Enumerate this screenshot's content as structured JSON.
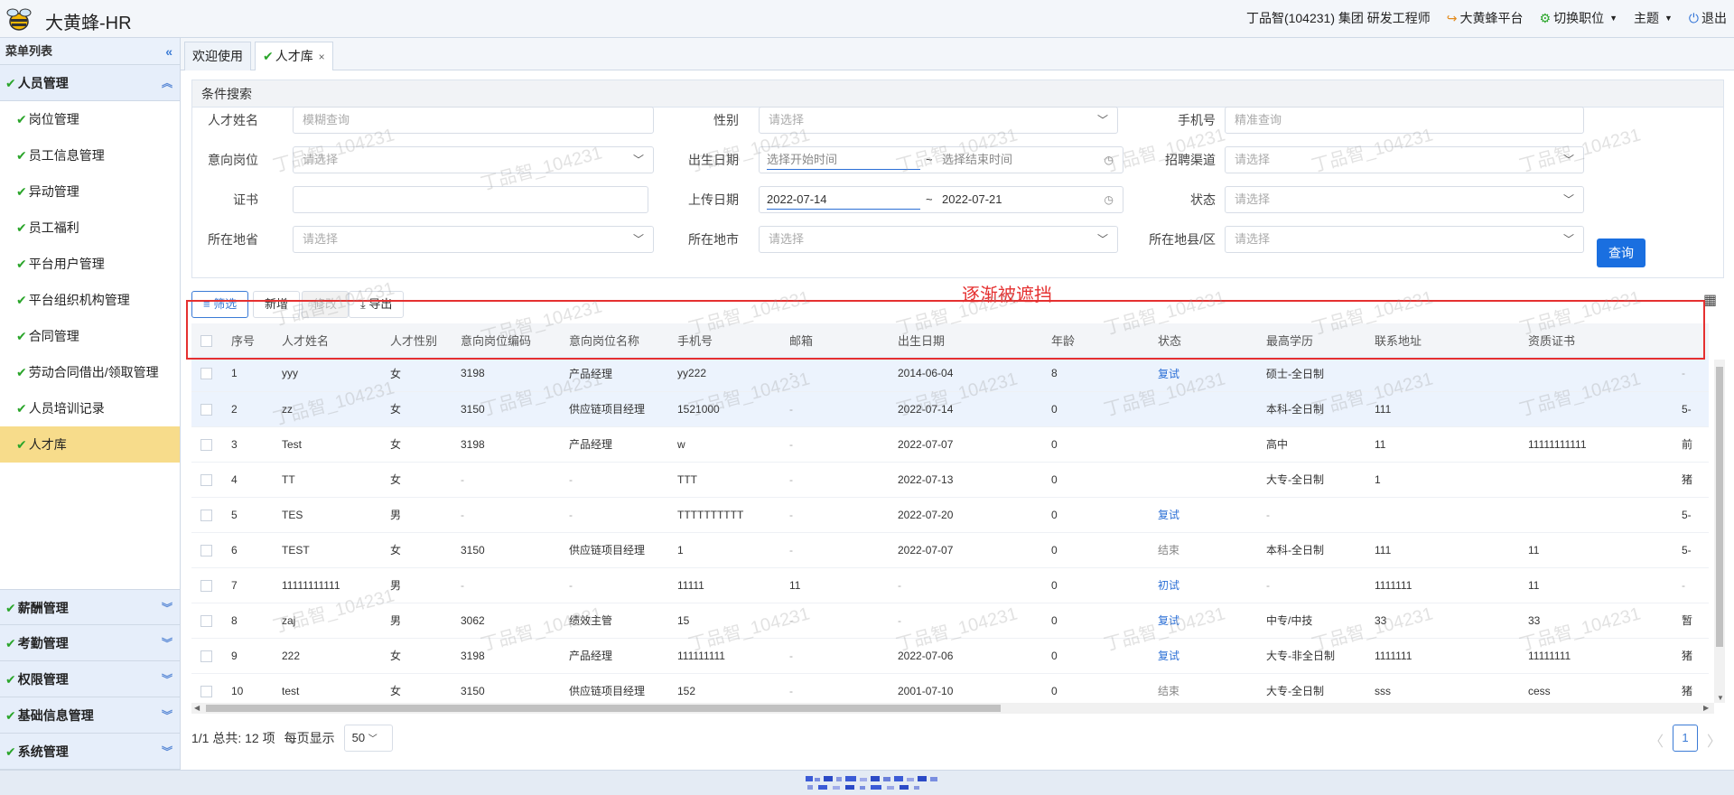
{
  "app": {
    "title": "大黄蜂-HR"
  },
  "topbar": {
    "user": "丁品智(104231) 集团 研发工程师",
    "platform": "大黄蜂平台",
    "switch_role": "切换职位",
    "theme": "主题",
    "logout": "退出"
  },
  "sidebar": {
    "header": "菜单列表",
    "active_group": "人员管理",
    "items": [
      {
        "label": "岗位管理"
      },
      {
        "label": "员工信息管理"
      },
      {
        "label": "异动管理"
      },
      {
        "label": "员工福利"
      },
      {
        "label": "平台用户管理"
      },
      {
        "label": "平台组织机构管理"
      },
      {
        "label": "合同管理"
      },
      {
        "label": "劳动合同借出/领取管理"
      },
      {
        "label": "人员培训记录"
      },
      {
        "label": "人才库"
      }
    ],
    "groups": [
      {
        "label": "薪酬管理"
      },
      {
        "label": "考勤管理"
      },
      {
        "label": "权限管理"
      },
      {
        "label": "基础信息管理"
      },
      {
        "label": "系统管理"
      }
    ]
  },
  "tabs": [
    {
      "label": "欢迎使用"
    },
    {
      "label": "人才库"
    }
  ],
  "search": {
    "title": "条件搜索",
    "name_label": "人才姓名",
    "name_placeholder": "模糊查询",
    "gender_label": "性别",
    "gender_placeholder": "请选择",
    "phone_label": "手机号",
    "phone_placeholder": "精准查询",
    "position_label": "意向岗位",
    "position_placeholder": "请选择",
    "birth_label": "出生日期",
    "birth_start": "选择开始时间",
    "birth_end": "选择结束时间",
    "channel_label": "招聘渠道",
    "channel_placeholder": "请选择",
    "cert_label": "证书",
    "upload_label": "上传日期",
    "upload_start": "2022-07-14",
    "upload_end": "2022-07-21",
    "status_label": "状态",
    "status_placeholder": "请选择",
    "province_label": "所在地省",
    "province_placeholder": "请选择",
    "city_label": "所在地市",
    "city_placeholder": "请选择",
    "district_label": "所在地县/区",
    "district_placeholder": "请选择",
    "date_sep": "~",
    "query_button": "查询"
  },
  "toolbar": {
    "filter": "筛选",
    "add": "新增",
    "edit": "修改",
    "export": "导出"
  },
  "annotation": "逐渐被遮挡",
  "watermark": "丁品智_104231",
  "table": {
    "columns": [
      "序号",
      "人才姓名",
      "人才性别",
      "意向岗位编码",
      "意向岗位名称",
      "手机号",
      "邮箱",
      "出生日期",
      "年龄",
      "状态",
      "最高学历",
      "联系地址",
      "资质证书",
      ""
    ],
    "rows": [
      [
        "1",
        "yyy",
        "女",
        "3198",
        "产品经理",
        "yy222",
        "-",
        "2014-06-04",
        "8",
        "复试",
        "硕士-全日制",
        "",
        "",
        "-"
      ],
      [
        "2",
        "zz",
        "女",
        "3150",
        "供应链项目经理",
        "1521000",
        "-",
        "2022-07-14",
        "0",
        "",
        "本科-全日制",
        "111",
        "",
        "5-"
      ],
      [
        "3",
        "Test",
        "女",
        "3198",
        "产品经理",
        "w",
        "-",
        "2022-07-07",
        "0",
        "",
        "高中",
        "11",
        "11111111111",
        "前"
      ],
      [
        "4",
        "TT",
        "女",
        "-",
        "-",
        "TTT",
        "-",
        "2022-07-13",
        "0",
        "",
        "大专-全日制",
        "1",
        "",
        "猪"
      ],
      [
        "5",
        "TES",
        "男",
        "-",
        "-",
        "TTTTTTTTTT",
        "-",
        "2022-07-20",
        "0",
        "复试",
        "-",
        "",
        "",
        "5-"
      ],
      [
        "6",
        "TEST",
        "女",
        "3150",
        "供应链项目经理",
        "1",
        "-",
        "2022-07-07",
        "0",
        "结束",
        "本科-全日制",
        "111",
        "11",
        "5-"
      ],
      [
        "7",
        "11111111111",
        "男",
        "-",
        "-",
        "11111",
        "11",
        "-",
        "0",
        "初试",
        "-",
        "1111111",
        "11",
        "-"
      ],
      [
        "8",
        "zaj",
        "男",
        "3062",
        "绩效主管",
        "15",
        "-",
        "-",
        "0",
        "复试",
        "中专/中技",
        "33",
        "33",
        "暂"
      ],
      [
        "9",
        "222",
        "女",
        "3198",
        "产品经理",
        "111111111",
        "-",
        "2022-07-06",
        "0",
        "复试",
        "大专-非全日制",
        "1111111",
        "11111111",
        "猪"
      ],
      [
        "10",
        "test",
        "女",
        "3150",
        "供应链项目经理",
        "152",
        "-",
        "2001-07-10",
        "0",
        "结束",
        "大专-全日制",
        "sss",
        "cess",
        "猪"
      ]
    ]
  },
  "pagination": {
    "summary": "1/1 总共: 12 项",
    "per_page_label": "每页显示",
    "per_page": "50",
    "current": "1"
  }
}
